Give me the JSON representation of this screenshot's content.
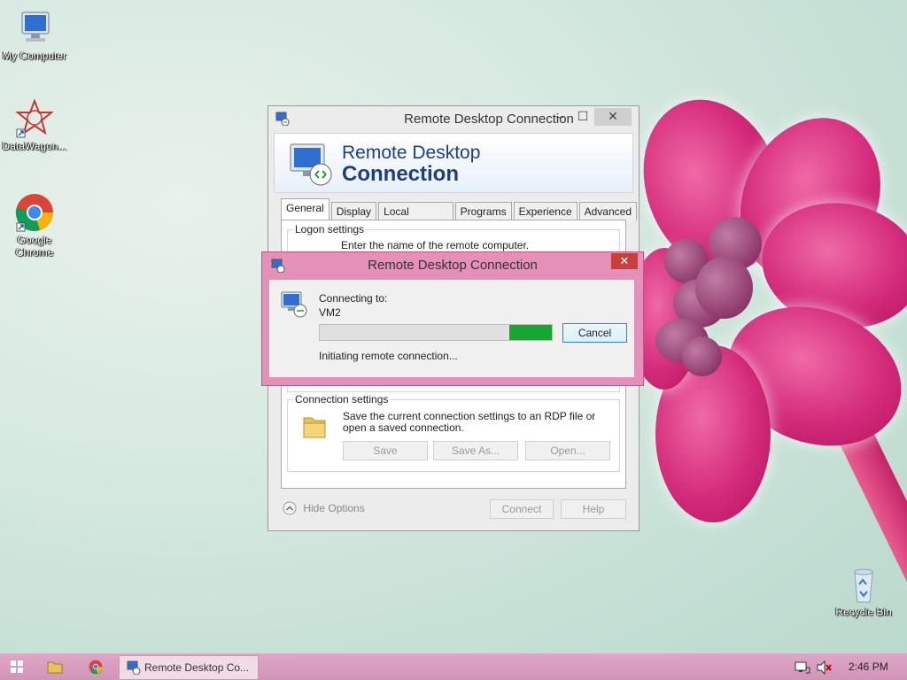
{
  "desktop": {
    "icons": [
      {
        "label": "My Computer",
        "icon": "computer-icon"
      },
      {
        "label": "DataWagon...",
        "icon": "datawagon-icon"
      },
      {
        "label": "Google Chrome",
        "icon": "chrome-icon"
      },
      {
        "label": "Recycle Bin",
        "icon": "recycle-bin-icon"
      }
    ]
  },
  "rdc_window": {
    "title": "Remote Desktop Connection",
    "banner_line1": "Remote Desktop",
    "banner_line2": "Connection",
    "tabs": [
      "General",
      "Display",
      "Local Resources",
      "Programs",
      "Experience",
      "Advanced"
    ],
    "active_tab": "General",
    "logon_group": "Logon settings",
    "logon_partial_text": "Enter the name of the remote computer.",
    "connection_group": "Connection settings",
    "connection_desc": "Save the current connection settings to an RDP file or open a saved connection.",
    "save_label": "Save",
    "save_as_label": "Save As...",
    "open_label": "Open...",
    "hide_options_label": "Hide Options",
    "connect_label": "Connect",
    "help_label": "Help"
  },
  "connecting_dialog": {
    "title": "Remote Desktop Connection",
    "connecting_to_label": "Connecting to:",
    "host": "VM2",
    "status": "Initiating remote connection...",
    "cancel_label": "Cancel",
    "progress_color": "#14a832"
  },
  "taskbar": {
    "task_label": "Remote Desktop Co...",
    "clock": "2:46 PM",
    "accent": "#d194b7"
  }
}
